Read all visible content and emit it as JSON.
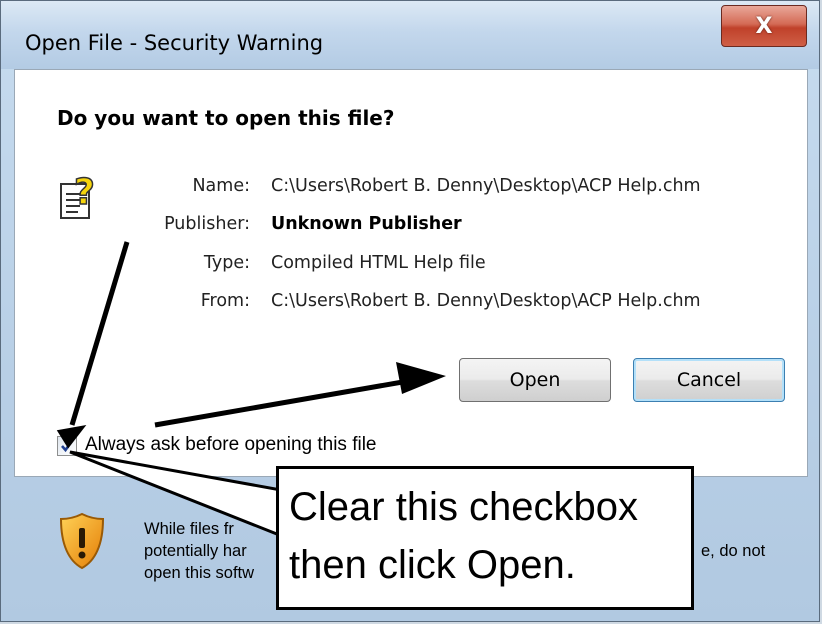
{
  "window": {
    "title": "Open File - Security Warning",
    "close_glyph": "X"
  },
  "dialog": {
    "question": "Do you want to open this file?",
    "fields": [
      {
        "label": "Name:",
        "value": "C:\\Users\\Robert B. Denny\\Desktop\\ACP Help.chm"
      },
      {
        "label": "Publisher:",
        "value": "Unknown Publisher"
      },
      {
        "label": "Type:",
        "value": "Compiled HTML Help file"
      },
      {
        "label": "From:",
        "value": "C:\\Users\\Robert B. Denny\\Desktop\\ACP Help.chm"
      }
    ],
    "open_label": "Open",
    "cancel_label": "Cancel",
    "checkbox": {
      "label": "Always ask before opening this file",
      "checked": true
    },
    "warning": {
      "line1": "While files fr",
      "line2": "potentially har",
      "line2_end": "e, do not",
      "line3": "open this softw"
    },
    "file_icon": "help-file-icon",
    "shield_icon": "warning-shield-icon"
  },
  "callout": {
    "line1": "Clear this checkbox",
    "line2": "then click Open."
  }
}
